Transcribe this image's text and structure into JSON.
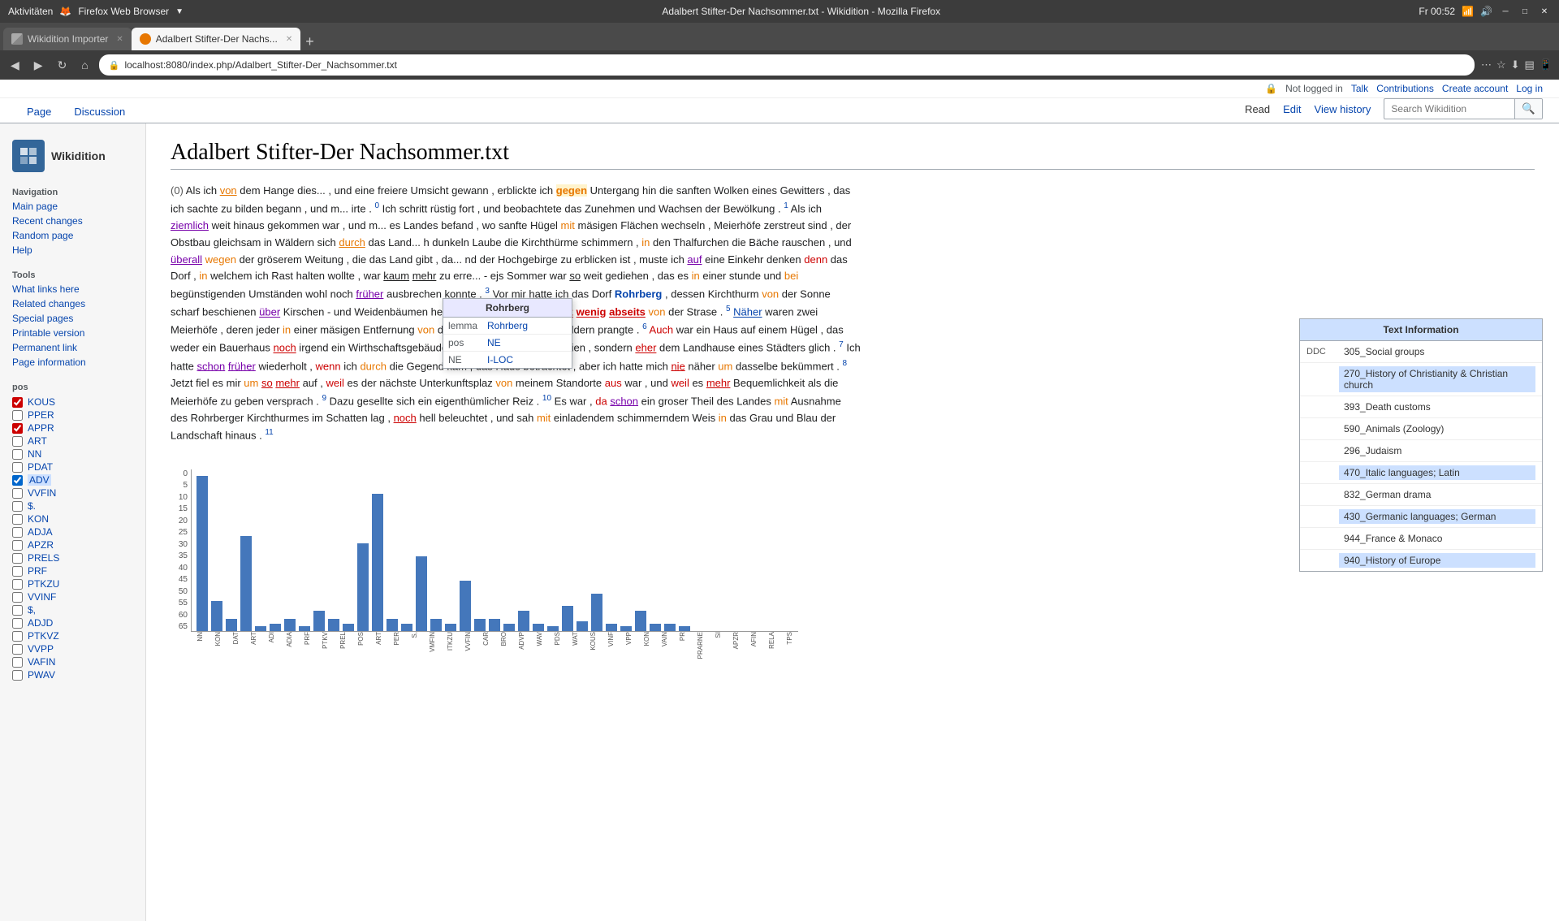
{
  "os": {
    "titlebar": "Aktivitäten",
    "browser_name": "Firefox Web Browser",
    "time": "Fr 00:52",
    "window_title": "Adalbert Stifter-Der Nachsommer.txt - Wikidition - Mozilla Firefox"
  },
  "browser": {
    "tabs": [
      {
        "id": "wikidition-importer",
        "label": "Wikidition Importer",
        "active": false,
        "favicon": "wikidition"
      },
      {
        "id": "adalbert",
        "label": "Adalbert Stifter-Der Nachs...",
        "active": true,
        "favicon": "firefox"
      }
    ],
    "url": "localhost:8080/index.php/Adalbert_Stifter-Der_Nachsommer.txt"
  },
  "wiki": {
    "logo_text": "Wikidition",
    "page_title": "Adalbert Stifter-Der Nachsommer.txt",
    "tabs": [
      {
        "id": "page",
        "label": "Page",
        "active": false
      },
      {
        "id": "discussion",
        "label": "Discussion",
        "active": false
      }
    ],
    "actions": [
      {
        "id": "read",
        "label": "Read",
        "active": true
      },
      {
        "id": "edit",
        "label": "Edit",
        "active": false
      },
      {
        "id": "view-history",
        "label": "View history",
        "active": false
      }
    ],
    "search_placeholder": "Search Wikidition",
    "user_area": {
      "not_logged_in": "Not logged in",
      "talk": "Talk",
      "contributions": "Contributions",
      "create_account": "Create account",
      "log_in": "Log in"
    },
    "sidebar": {
      "navigation_title": "Navigation",
      "nav_links": [
        {
          "id": "main-page",
          "label": "Main page"
        },
        {
          "id": "recent-changes",
          "label": "Recent changes"
        },
        {
          "id": "random-page",
          "label": "Random page"
        },
        {
          "id": "help",
          "label": "Help"
        }
      ],
      "tools_title": "Tools",
      "tool_links": [
        {
          "id": "what-links-here",
          "label": "What links here"
        },
        {
          "id": "related-changes",
          "label": "Related changes"
        },
        {
          "id": "special-pages",
          "label": "Special pages"
        },
        {
          "id": "printable-version",
          "label": "Printable version"
        },
        {
          "id": "permanent-link",
          "label": "Permanent link"
        },
        {
          "id": "page-information",
          "label": "Page information"
        }
      ],
      "pos_title": "pos",
      "pos_items": [
        {
          "id": "KOUS",
          "label": "KOUS",
          "checked": true,
          "color": "#cc0000"
        },
        {
          "id": "PPER",
          "label": "PPER",
          "checked": false
        },
        {
          "id": "APPR",
          "label": "APPR",
          "checked": true,
          "color": "#cc0000"
        },
        {
          "id": "ART",
          "label": "ART",
          "checked": false
        },
        {
          "id": "NN",
          "label": "NN",
          "checked": false
        },
        {
          "id": "PDAT",
          "label": "PDAT",
          "checked": false
        },
        {
          "id": "ADV",
          "label": "ADV",
          "checked": true,
          "color": "#0066cc"
        },
        {
          "id": "VVFIN",
          "label": "VVFIN",
          "checked": false
        },
        {
          "id": "S_DOT",
          "label": "$.",
          "checked": false
        },
        {
          "id": "KON",
          "label": "KON",
          "checked": false
        },
        {
          "id": "ADJA",
          "label": "ADJA",
          "checked": false
        },
        {
          "id": "APZR",
          "label": "APZR",
          "checked": false
        },
        {
          "id": "PRELS",
          "label": "PRELS",
          "checked": false
        },
        {
          "id": "PRF",
          "label": "PRF",
          "checked": false
        },
        {
          "id": "PTKZU",
          "label": "PTKZU",
          "checked": false
        },
        {
          "id": "VVINF",
          "label": "VVINF",
          "checked": false
        },
        {
          "id": "S_COMMA",
          "label": "$,",
          "checked": false
        },
        {
          "id": "ADJD",
          "label": "ADJD",
          "checked": false
        },
        {
          "id": "PTKVZ",
          "label": "PTKVZ",
          "checked": false
        },
        {
          "id": "VVPP",
          "label": "VVPP",
          "checked": false
        },
        {
          "id": "VAFIN",
          "label": "VAFIN",
          "checked": false
        },
        {
          "id": "PWAV",
          "label": "PWAV",
          "checked": false
        }
      ]
    },
    "tooltip": {
      "title": "Rohrberg",
      "rows": [
        {
          "key": "lemma",
          "value": "Rohrberg"
        },
        {
          "key": "pos",
          "value": "NE"
        },
        {
          "key": "NE",
          "value": "I-LOC"
        }
      ]
    },
    "text_paragraph": "(0) Als ich von dem Hange dies... , und eine freiere Umsicht gewann , erblickte ich gegen Untergang hin die sanften Wolken eines Gewitters , das ich sachte zu bilden begann , und m... irte . 0 Ich schritt rüstig fort , und beobachtete das Zunehmen und Wachsen der Bewölkung . 1 Als ich ziemlich weit hinaus gekommen war , und m... es Landes befand , wo sanfte Hügel mit mäsigen Flächen wechseln , Meierhöfe zerstreut sind , der Obstbau gleichsam in Wäldern sich durch das Land... h dunkeln Laube die Kirchthürme schimmern , in den Thalfurchen die Bäche rauschen , und überall wegen der gröserem Weitung , die das Land gibt , da... nd der Hochgebirge zu erblicken ist , muste ich auf eine Einkehr denken denn das Dorf , in welchem ich Rast halten wollte , war kaum mehr zu erre... - ejs Sommer war so weit gediehen , das es in einer stunde und bei begünstigenden Umständen wohl noch früher ausbrechen konnte . 3 Vor mir hatte ich das Dorf Rohrberg , dessen Kirchthurm von der Sonne scharf beschienen über Kirschen - und Weidenbäumen hervor sah . 4 Es lag nur ganz wenig abseits von der Strase . 5 Näher waren zwei Meierhöfe , deren jeder in einer mäsigen Entfernung von der Strase in Wiesen und Feldern prangte . 6 Auch war ein Haus auf einem Hügel , das weder ein Bauerhaus noch irgend ein Wirthschaftsgebäude eines Bürgers zu sein schien , sondern eher dem Landhause eines Städters glich . 7 Ich hatte schon früher wiederholt , wenn ich durch die Gegend kam , das Haus betrachtet , aber ich hatte mich nie näher um dasselbe bekümmert . 8 Jetzt fiel es mir um so mehr auf , weil es der nächste Unterkunftsplaz von meinem Standorte aus war , und weil es mehr Bequemlichkeit als die Meierhöfe zu geben versprach . 9 Dazu gesellte sich ein eigenthümlicher Reiz . 10 Es war , da schon ein groser Theil des Landes mit Ausnahme des Rohrberger Kirchthurmes im Schatten lag , noch hell beleuchtet , und sah mit einladendem schimmerndem Weis in das Grau und Blau der Landschaft hinaus . 11",
    "info_panel": {
      "title": "Text Information",
      "ddc_label": "DDC",
      "categories": [
        {
          "ddc": "305",
          "label": "305_Social groups",
          "highlighted": false
        },
        {
          "ddc": "270",
          "label": "270_History of Christianity & Christian church",
          "highlighted": true
        },
        {
          "ddc": "393",
          "label": "393_Death customs",
          "highlighted": false
        },
        {
          "ddc": "590",
          "label": "590_Animals (Zoology)",
          "highlighted": false
        },
        {
          "ddc": "296",
          "label": "296_Judaism",
          "highlighted": false
        },
        {
          "ddc": "470",
          "label": "470_Italic languages; Latin",
          "highlighted": true
        },
        {
          "ddc": "832",
          "label": "832_German drama",
          "highlighted": false
        },
        {
          "ddc": "430",
          "label": "430_Germanic languages; German",
          "highlighted": true
        },
        {
          "ddc": "944",
          "label": "944_France & Monaco",
          "highlighted": false
        },
        {
          "ddc": "940",
          "label": "940_History of Europe",
          "highlighted": true
        }
      ]
    },
    "chart": {
      "y_labels": [
        "65",
        "60",
        "55",
        "50",
        "45",
        "40",
        "35",
        "30",
        "25",
        "20",
        "15",
        "10",
        "5",
        "0"
      ],
      "bars": [
        {
          "label": "NN",
          "value": 62
        },
        {
          "label": "KON",
          "value": 12
        },
        {
          "label": "DAT",
          "value": 5
        },
        {
          "label": "ART",
          "value": 38
        },
        {
          "label": "ADI",
          "value": 2
        },
        {
          "label": "ADIA",
          "value": 3
        },
        {
          "label": "PRF",
          "value": 5
        },
        {
          "label": "PTKV",
          "value": 2
        },
        {
          "label": "PREL",
          "value": 8
        },
        {
          "label": "POS",
          "value": 5
        },
        {
          "label": "ART",
          "value": 3
        },
        {
          "label": "PER",
          "value": 35
        },
        {
          "label": "S,",
          "value": 55
        },
        {
          "label": "VMFIN",
          "value": 5
        },
        {
          "label": "ITKZU",
          "value": 3
        },
        {
          "label": "VVFIN",
          "value": 30
        },
        {
          "label": "CAR",
          "value": 5
        },
        {
          "label": "BRO",
          "value": 3
        },
        {
          "label": "ADVP",
          "value": 20
        },
        {
          "label": "WAV",
          "value": 5
        },
        {
          "label": "PDS",
          "value": 5
        },
        {
          "label": "WAT",
          "value": 3
        },
        {
          "label": "KOUS",
          "value": 8
        },
        {
          "label": "VINF",
          "value": 3
        },
        {
          "label": "VPP",
          "value": 2
        },
        {
          "label": "KON",
          "value": 10
        },
        {
          "label": "VAIN",
          "value": 4
        },
        {
          "label": "PR",
          "value": 15
        },
        {
          "label": "PRARNE",
          "value": 3
        },
        {
          "label": "SI",
          "value": 2
        },
        {
          "label": "APZR",
          "value": 8
        },
        {
          "label": "AFIN",
          "value": 3
        },
        {
          "label": "RELA",
          "value": 3
        },
        {
          "label": "TPS",
          "value": 2
        }
      ]
    }
  }
}
